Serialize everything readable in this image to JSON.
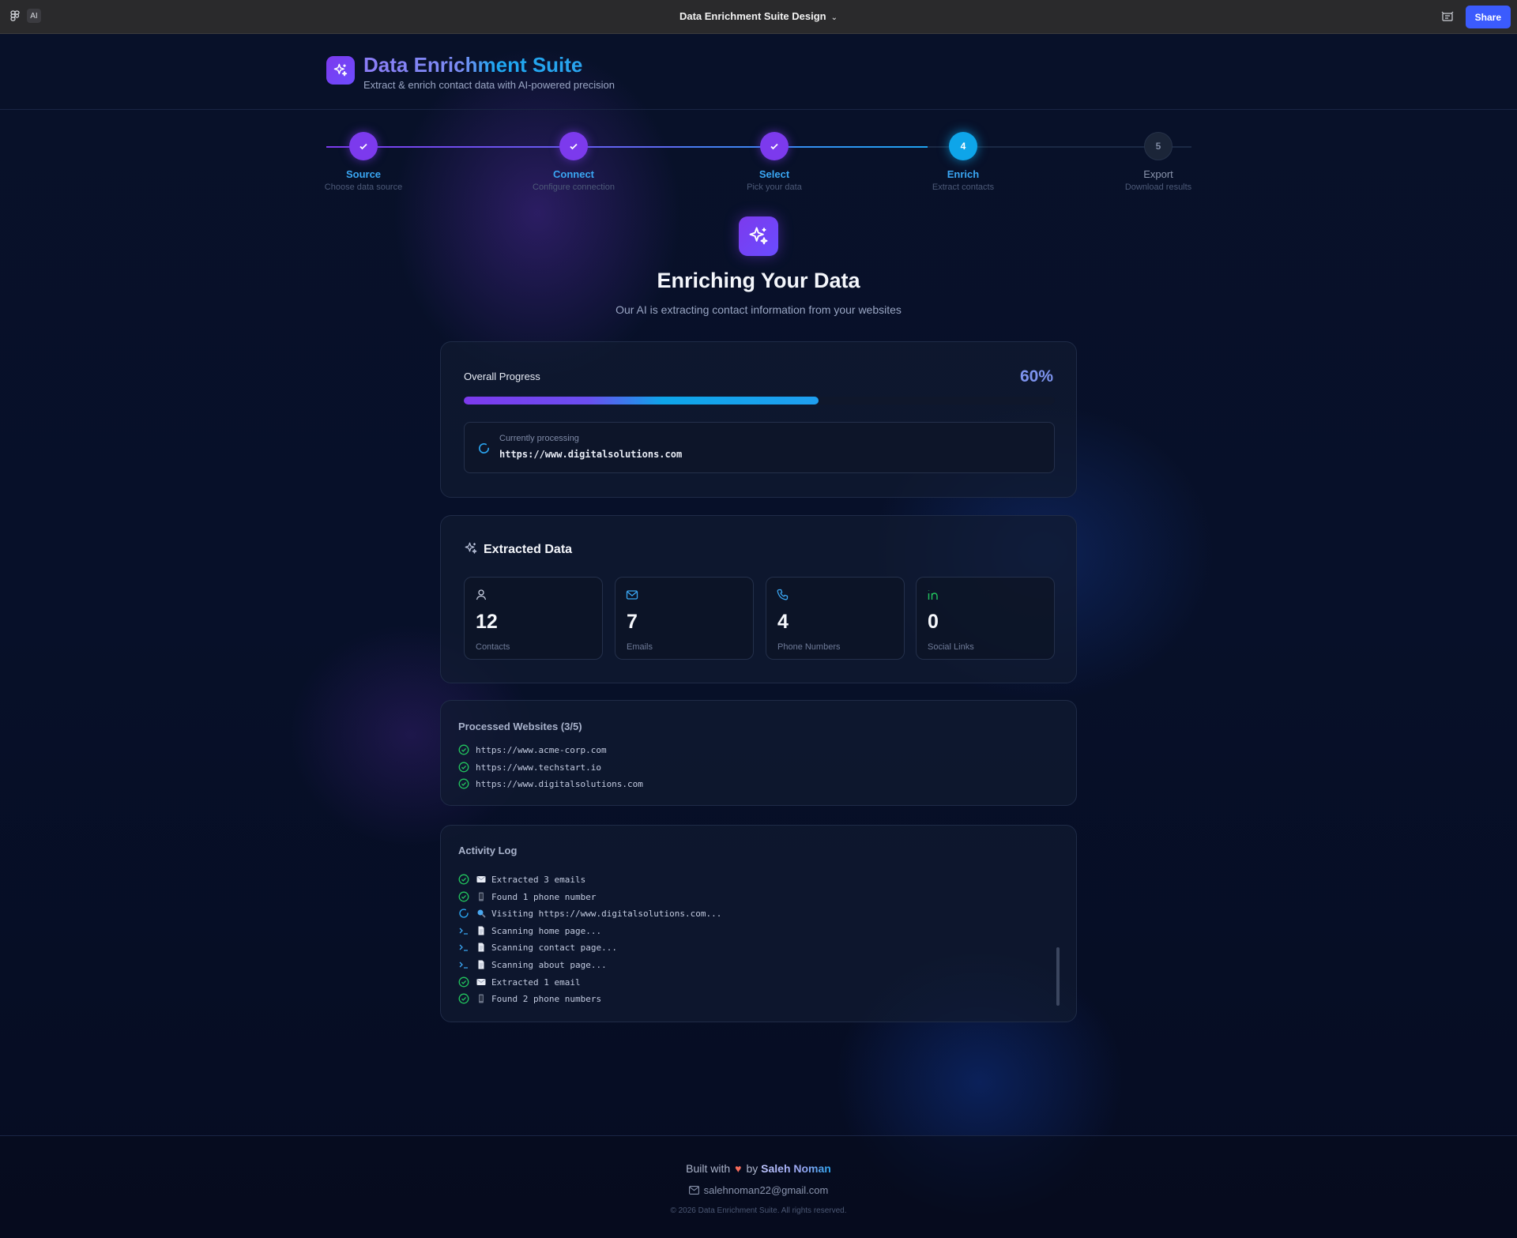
{
  "topbar": {
    "ai_badge": "AI",
    "title": "Data Enrichment Suite Design",
    "share_label": "Share"
  },
  "header": {
    "title": "Data Enrichment Suite",
    "subtitle": "Extract & enrich contact data with AI-powered precision"
  },
  "steps": [
    {
      "label": "Source",
      "desc": "Choose data source",
      "state": "done"
    },
    {
      "label": "Connect",
      "desc": "Configure connection",
      "state": "done"
    },
    {
      "label": "Select",
      "desc": "Pick your data",
      "state": "done"
    },
    {
      "number": "4",
      "label": "Enrich",
      "desc": "Extract contacts",
      "state": "active"
    },
    {
      "number": "5",
      "label": "Export",
      "desc": "Download results",
      "state": "todo"
    }
  ],
  "hero": {
    "title": "Enriching Your Data",
    "subtitle": "Our AI is extracting contact information from your websites"
  },
  "progress": {
    "label": "Overall Progress",
    "percent_text": "60%",
    "value": 0.6,
    "processing_label": "Currently processing",
    "processing_url": "https://www.digitalsolutions.com"
  },
  "extracted": {
    "title": "Extracted Data",
    "stats": [
      {
        "value": "12",
        "label": "Contacts",
        "icon": "user-icon"
      },
      {
        "value": "7",
        "label": "Emails",
        "icon": "mail-icon"
      },
      {
        "value": "4",
        "label": "Phone Numbers",
        "icon": "phone-icon"
      },
      {
        "value": "0",
        "label": "Social Links",
        "icon": "linkedin-icon"
      }
    ]
  },
  "processed": {
    "title": "Processed Websites (3/5)",
    "sites": [
      "https://www.acme-corp.com",
      "https://www.techstart.io",
      "https://www.digitalsolutions.com"
    ]
  },
  "activity": {
    "title": "Activity Log",
    "entries": [
      {
        "status": "done",
        "emoji": "envelope",
        "text": "Extracted 3 emails"
      },
      {
        "status": "done",
        "emoji": "phone",
        "text": "Found 1 phone number"
      },
      {
        "status": "running",
        "emoji": "magnifier",
        "text": "Visiting https://www.digitalsolutions.com..."
      },
      {
        "status": "terminal",
        "emoji": "page",
        "text": "Scanning home page..."
      },
      {
        "status": "terminal",
        "emoji": "page",
        "text": "Scanning contact page..."
      },
      {
        "status": "terminal",
        "emoji": "page",
        "text": "Scanning about page..."
      },
      {
        "status": "done",
        "emoji": "envelope",
        "text": "Extracted 1 email"
      },
      {
        "status": "done",
        "emoji": "phone",
        "text": "Found 2 phone numbers"
      }
    ]
  },
  "footer": {
    "built_with": "Built with",
    "by": "by",
    "author": "Saleh Noman",
    "email": "salehnoman22@gmail.com",
    "copyright": "© 2026 Data Enrichment Suite. All rights reserved."
  },
  "colors": {
    "accent_purple": "#7c3aed",
    "accent_blue": "#0ea5e9",
    "success_green": "#22c55e",
    "share_blue": "#3b5bfd",
    "background": "#070d1f"
  }
}
